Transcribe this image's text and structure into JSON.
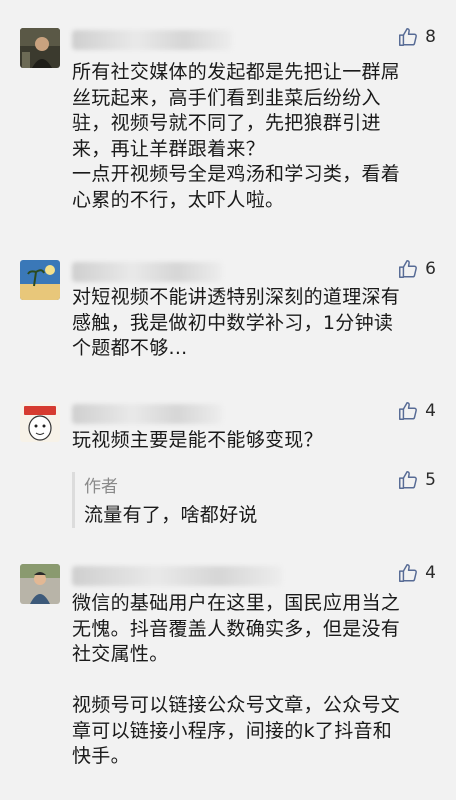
{
  "comments": [
    {
      "likes": "8",
      "text": "所有社交媒体的发起都是先把让一群屌\n丝玩起来，高手们看到韭菜后纷纷入\n驻，视频号就不同了，先把狼群引进\n来，再让羊群跟着来？\n一点开视频号全是鸡汤和学习类，看着\n心累的不行，太吓人啦。"
    },
    {
      "likes": "6",
      "text": "对短视频不能讲透特别深刻的道理深有\n感触，我是做初中数学补习，1分钟读\n个题都不够..."
    },
    {
      "likes": "4",
      "text": "玩视频主要是能不能够变现？",
      "reply": {
        "author": "作者",
        "likes": "5",
        "text": "流量有了，啥都好说"
      }
    },
    {
      "likes": "4",
      "text": "微信的基础用户在这里，国民应用当之\n无愧。抖音覆盖人数确实多，但是没有\n社交属性。\n\n视频号可以链接公众号文章，公众号文\n章可以链接小程序，间接的k了抖音和\n快手。"
    }
  ],
  "colors": {
    "background": "#f2f2f2",
    "like_icon": "#576b95"
  },
  "icons": [
    "thumbs-up-icon"
  ]
}
